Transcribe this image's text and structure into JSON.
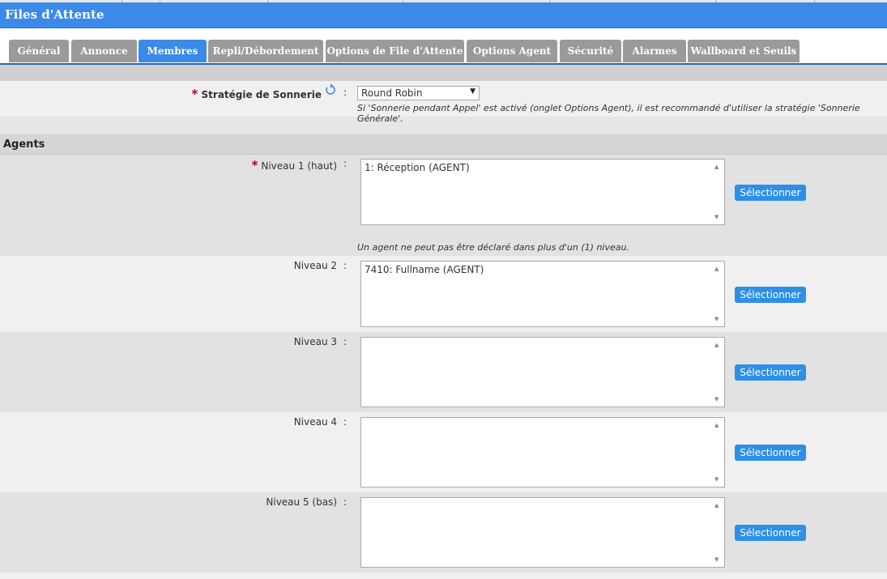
{
  "window": {
    "title": "Files d'Attente"
  },
  "tabs": [
    {
      "label": "Général",
      "active": false
    },
    {
      "label": "Annonce",
      "active": false
    },
    {
      "label": "Membres",
      "active": true
    },
    {
      "label": "Repli/Débordement",
      "active": false
    },
    {
      "label": "Options de File d'Attente",
      "active": false
    },
    {
      "label": "Options Agent",
      "active": false
    },
    {
      "label": "Sécurité",
      "active": false
    },
    {
      "label": "Alarmes",
      "active": false
    },
    {
      "label": "Wallboard et Seuils",
      "active": false
    }
  ],
  "strategy": {
    "label": "Stratégie de Sonnerie",
    "required_marker": "*",
    "colon": ":",
    "value": "Round Robin",
    "hint": "Si 'Sonnerie pendant Appel' est activé (onglet Options Agent), il est recommandé d'utiliser la stratégie 'Sonnerie Générale'."
  },
  "agents": {
    "section_title": "Agents",
    "level_hint": "Un agent ne peut pas être déclaré dans plus d'un (1) niveau.",
    "select_label": "Sélectionner",
    "levels": [
      {
        "label": "Niveau 1 (haut)",
        "required": true,
        "items": [
          "1: Réception (AGENT)"
        ]
      },
      {
        "label": "Niveau 2",
        "required": false,
        "items": [
          "7410: Fullname (AGENT)"
        ]
      },
      {
        "label": "Niveau 3",
        "required": false,
        "items": []
      },
      {
        "label": "Niveau 4",
        "required": false,
        "items": []
      },
      {
        "label": "Niveau 5 (bas)",
        "required": false,
        "items": []
      }
    ]
  },
  "colors": {
    "accent": "#3b8ae9",
    "tab_inactive": "#9a9a9a",
    "required": "#b00020",
    "button": "#2d8fe8"
  },
  "icons": {
    "refresh": "refresh-icon",
    "dropdown": "chevron-down-icon",
    "scroll_up": "scroll-up-icon",
    "scroll_down": "scroll-down-icon"
  }
}
